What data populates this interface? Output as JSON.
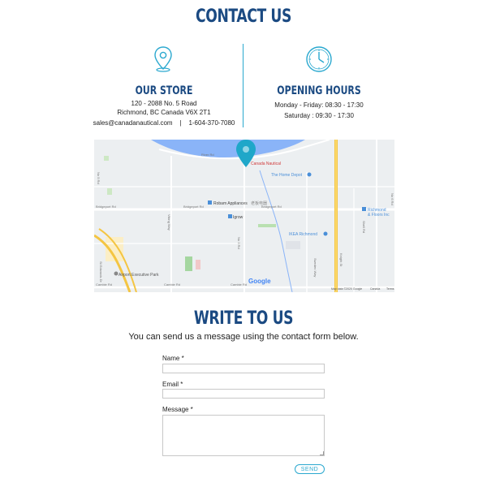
{
  "contact": {
    "title": "CONTACT US",
    "store": {
      "title": "OUR STORE",
      "address_line1": "120 - 2088 No. 5 Road",
      "address_line2": "Richmond, BC  Canada  V6X 2T1",
      "email": "sales@canadanautical.com",
      "separator": "|",
      "phone": "1-604-370-7080"
    },
    "hours": {
      "title": "OPENING HOURS",
      "weekday": "Monday - Friday: 08:30 - 17:30",
      "saturday": "Saturday : 09:30 - 17:30"
    }
  },
  "map": {
    "marker_label": "Canada Nautical",
    "places": {
      "home_depot": "The Home Depot",
      "robam": "Robam Appliances",
      "robam_cn": "老板电器",
      "igrow": "Igrow",
      "ikea": "IKEA Richmond",
      "airport_park": "Airport Executive Park",
      "richmond_floors_1": "Richmond",
      "richmond_floors_2": "& Floors Inc"
    },
    "roads": {
      "river_rd": "River Rd",
      "bridgeport_rd_1": "Bridgeport Rd",
      "bridgeport_rd_2": "Bridgeport Rd",
      "bridgeport_rd_3": "Bridgeport Rd",
      "knight_st": "Knight St",
      "sweden_way": "Sweden Way",
      "no6_rd": "No 6 Rd",
      "no5_rd": "No 5 Rd",
      "shell_rd": "Shell Rd",
      "cambie_rd_1": "Cambie Rd",
      "cambie_rd_2": "Cambie Rd",
      "cambie_rd_3": "Cambie Rd",
      "st_edwards": "St Edwards Dr",
      "no3_rd": "No 3 Rd",
      "viking_way": "Viking Way"
    },
    "google_logo": "Google",
    "attribution": "Map data ©2020 Google",
    "country": "Canada",
    "terms": "Terms"
  },
  "form": {
    "title": "WRITE TO US",
    "intro": "You can send us a message using the contact form below.",
    "name_label": "Name *",
    "email_label": "Email *",
    "message_label": "Message *",
    "name_value": "",
    "email_value": "",
    "message_value": "",
    "send_label": "SEND"
  },
  "colors": {
    "heading": "#1b4a82",
    "accent": "#2aa8cf",
    "water": "#8ab4f8"
  }
}
